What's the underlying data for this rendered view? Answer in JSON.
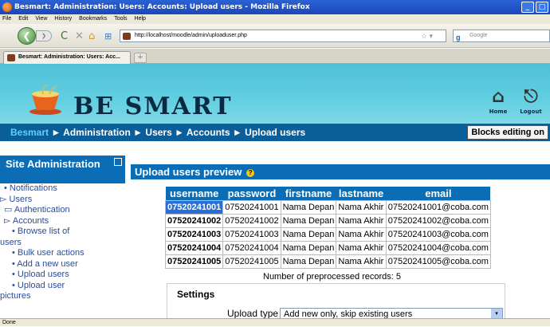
{
  "window": {
    "title": "Besmart: Administration: Users: Accounts: Upload users - Mozilla Firefox"
  },
  "menu": [
    "File",
    "Edit",
    "View",
    "History",
    "Bookmarks",
    "Tools",
    "Help"
  ],
  "navbar": {
    "url": "http://localhost/moodle/admin/uploaduser.php",
    "search_placeholder": "Google"
  },
  "tab": {
    "label": "Besmart: Administration: Users: Acc..."
  },
  "header": {
    "logo": "BE SMART",
    "home_label": "Home",
    "logout_label": "Logout"
  },
  "breadcrumb": {
    "items": [
      "Besmart",
      "Administration",
      "Users",
      "Accounts",
      "Upload users"
    ],
    "separator": "►"
  },
  "blocks_button": "Blocks editing on",
  "sidebar": {
    "title": "Site Administration",
    "items": [
      "• Notifications",
      "▻ Users",
      "▭ Authentication",
      "▻ Accounts",
      "• Browse list of",
      "users",
      "• Bulk user actions",
      "• Add a new user",
      "• Upload users",
      "• Upload user",
      "pictures"
    ]
  },
  "main": {
    "title": "Upload users preview",
    "table": {
      "headers": [
        "username",
        "password",
        "firstname",
        "lastname",
        "email"
      ],
      "rows": [
        [
          "07520241001",
          "07520241001",
          "Nama Depan",
          "Nama Akhir",
          "07520241001@coba.com"
        ],
        [
          "07520241002",
          "07520241002",
          "Nama Depan",
          "Nama Akhir",
          "07520241002@coba.com"
        ],
        [
          "07520241003",
          "07520241003",
          "Nama Depan",
          "Nama Akhir",
          "07520241003@coba.com"
        ],
        [
          "07520241004",
          "07520241004",
          "Nama Depan",
          "Nama Akhir",
          "07520241004@coba.com"
        ],
        [
          "07520241005",
          "07520241005",
          "Nama Depan",
          "Nama Akhir",
          "07520241005@coba.com"
        ]
      ]
    },
    "count_text": "Number of preprocessed records: 5",
    "settings": {
      "legend": "Settings",
      "upload_type_label": "Upload type",
      "upload_type_value": "Add new only, skip existing users"
    }
  },
  "status": "Done",
  "colors": {
    "header": "#5ccbe0",
    "accent": "#0a6db5",
    "breadcrumb_bg": "#0a5f9a"
  }
}
